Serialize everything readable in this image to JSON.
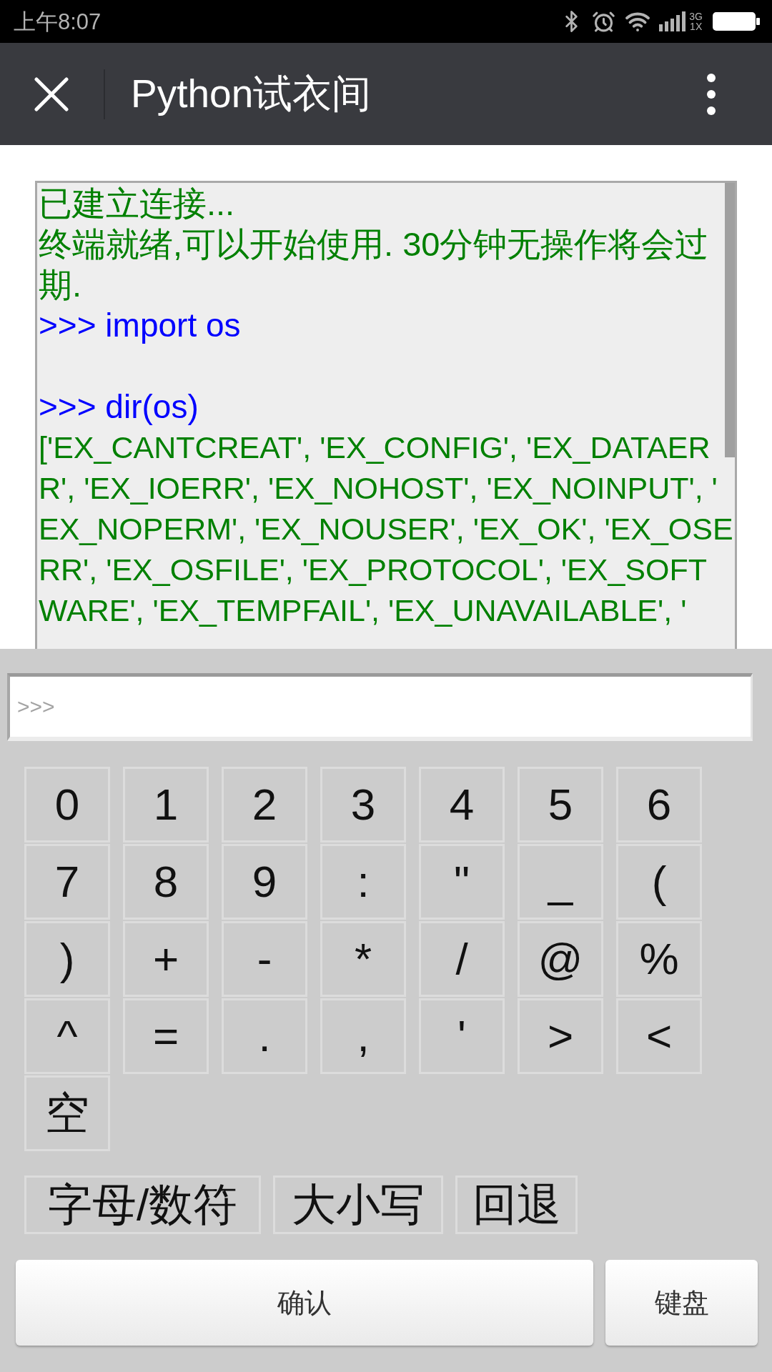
{
  "status_bar": {
    "time": "上午8:07",
    "network_type": [
      "3G",
      "1X"
    ]
  },
  "app_bar": {
    "title": "Python试衣间"
  },
  "terminal": {
    "lines": [
      {
        "kind": "message",
        "text": "已建立连接..."
      },
      {
        "kind": "message",
        "text": "终端就绪,可以开始使用. 30分钟无操作将会过"
      },
      {
        "kind": "message",
        "text": "期."
      },
      {
        "kind": "command",
        "text": ">>> import os"
      },
      {
        "kind": "blank"
      },
      {
        "kind": "command",
        "text": ">>> dir(os)"
      },
      {
        "kind": "output",
        "text": "['EX_CANTCREAT', 'EX_CONFIG', 'EX_DATAER"
      },
      {
        "kind": "output",
        "text": "R', 'EX_IOERR', 'EX_NOHOST', 'EX_NOINPUT', '"
      },
      {
        "kind": "output",
        "text": "EX_NOPERM', 'EX_NOUSER', 'EX_OK', 'EX_OSE"
      },
      {
        "kind": "output",
        "text": "RR', 'EX_OSFILE', 'EX_PROTOCOL', 'EX_SOFT"
      },
      {
        "kind": "output",
        "text": "WARE', 'EX_TEMPFAIL', 'EX_UNAVAILABLE', '"
      }
    ]
  },
  "input": {
    "placeholder": ">>>"
  },
  "keypad": {
    "keys": [
      "0",
      "1",
      "2",
      "3",
      "4",
      "5",
      "6",
      "7",
      "8",
      "9",
      ":",
      "\"",
      "_",
      "(",
      ")",
      "+",
      "-",
      "*",
      "/",
      "@",
      "%",
      "^",
      "=",
      ".",
      ",",
      "'",
      ">",
      "<",
      "空"
    ]
  },
  "function_keys": [
    "字母/数符",
    "大小写",
    "回退"
  ],
  "buttons": [
    "确认",
    "键盘"
  ]
}
